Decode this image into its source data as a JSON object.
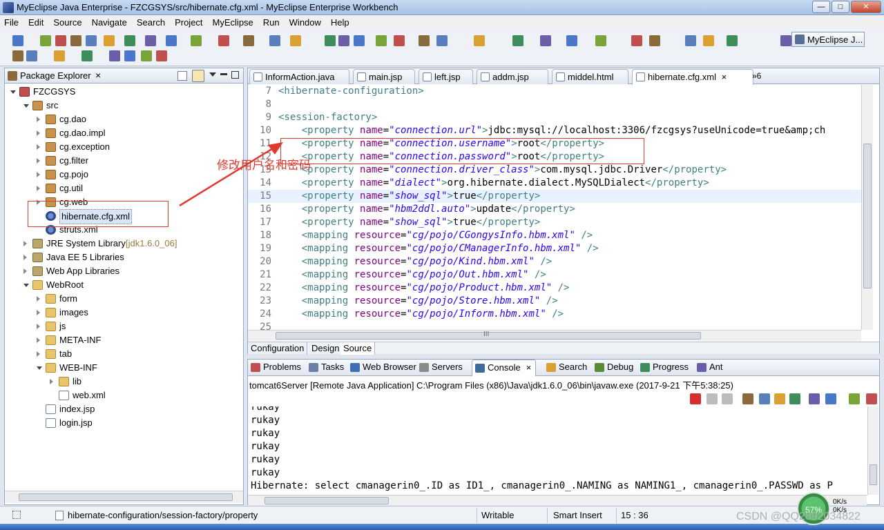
{
  "window": {
    "title": "MyEclipse Java Enterprise - FZCGSYS/src/hibernate.cfg.xml - MyEclipse Enterprise Workbench",
    "min": "0",
    "max": "1",
    "close": "r"
  },
  "menu": [
    "File",
    "Edit",
    "Source",
    "Navigate",
    "Search",
    "Project",
    "MyEclipse",
    "Run",
    "Window",
    "Help"
  ],
  "perspective": {
    "label": "MyEclipse J..."
  },
  "package_explorer": {
    "title": "Package Explorer",
    "close": "×",
    "tree": [
      {
        "label": "FZCGSYS",
        "icon": "project-icon",
        "depth": 0,
        "open": true
      },
      {
        "label": "src",
        "icon": "source-folder-icon",
        "depth": 1,
        "open": true
      },
      {
        "label": "cg.dao",
        "icon": "package-icon",
        "depth": 2
      },
      {
        "label": "cg.dao.impl",
        "icon": "package-icon",
        "depth": 2
      },
      {
        "label": "cg.exception",
        "icon": "package-icon",
        "depth": 2
      },
      {
        "label": "cg.filter",
        "icon": "package-icon",
        "depth": 2
      },
      {
        "label": "cg.pojo",
        "icon": "package-icon",
        "depth": 2
      },
      {
        "label": "cg.util",
        "icon": "package-icon",
        "depth": 2
      },
      {
        "label": "cg.web",
        "icon": "package-icon",
        "depth": 2
      },
      {
        "label": "hibernate.cfg.xml",
        "icon": "hibernate-config-icon",
        "depth": 2,
        "selected": true
      },
      {
        "label": "struts.xml",
        "icon": "xml-config-icon",
        "depth": 2
      },
      {
        "label": "JRE System Library",
        "suffix": "[jdk1.6.0_06]",
        "icon": "library-icon",
        "depth": 1
      },
      {
        "label": "Java EE 5 Libraries",
        "icon": "library-icon",
        "depth": 1
      },
      {
        "label": "Web App Libraries",
        "icon": "library-icon",
        "depth": 1
      },
      {
        "label": "WebRoot",
        "icon": "folder-icon",
        "depth": 1,
        "open": true
      },
      {
        "label": "form",
        "icon": "folder-icon",
        "depth": 2
      },
      {
        "label": "images",
        "icon": "folder-icon",
        "depth": 2
      },
      {
        "label": "js",
        "icon": "folder-icon",
        "depth": 2
      },
      {
        "label": "META-INF",
        "icon": "folder-icon",
        "depth": 2
      },
      {
        "label": "tab",
        "icon": "folder-icon",
        "depth": 2
      },
      {
        "label": "WEB-INF",
        "icon": "folder-icon",
        "depth": 2,
        "open": true
      },
      {
        "label": "lib",
        "icon": "folder-icon",
        "depth": 3
      },
      {
        "label": "web.xml",
        "icon": "xml-file-icon",
        "depth": 3
      },
      {
        "label": "index.jsp",
        "icon": "jsp-file-icon",
        "depth": 2
      },
      {
        "label": "login.jsp",
        "icon": "jsp-file-icon",
        "depth": 2
      }
    ]
  },
  "editor": {
    "tabs": [
      "InformAction.java",
      "main.jsp",
      "left.jsp",
      "addm.jsp",
      "middel.html",
      "hibernate.cfg.xml"
    ],
    "active_tab": 5,
    "overflow": "»6",
    "lines": [
      {
        "n": "7",
        "html": "<span class=\"tag\">&lt;hibernate-configuration&gt;</span>"
      },
      {
        "n": "8",
        "html": ""
      },
      {
        "n": "9",
        "html": "<span class=\"tag\">&lt;session-factory&gt;</span>"
      },
      {
        "n": "10",
        "html": "    <span class=\"tag\">&lt;property</span> <span class=\"att\">name</span>=<span class=\"val\">\"connection.url\"</span><span class=\"tag\">&gt;</span>jdbc:mysql://localhost:3306/fzcgsys?useUnicode=true&amp;amp;ch"
      },
      {
        "n": "11",
        "html": "    <span class=\"tag\">&lt;property</span> <span class=\"att\">name</span>=<span class=\"val\">\"connection.username\"</span><span class=\"tag\">&gt;</span>root<span class=\"tag\">&lt;/property&gt;</span>"
      },
      {
        "n": "12",
        "html": "    <span class=\"tag\">&lt;property</span> <span class=\"att\">name</span>=<span class=\"val\">\"connection.password\"</span><span class=\"tag\">&gt;</span>root<span class=\"tag\">&lt;/property&gt;</span>"
      },
      {
        "n": "13",
        "html": "    <span class=\"tag\">&lt;property</span> <span class=\"att\">name</span>=<span class=\"val\">\"connection.driver_class\"</span><span class=\"tag\">&gt;</span>com.mysql.jdbc.Driver<span class=\"tag\">&lt;/property&gt;</span>"
      },
      {
        "n": "14",
        "html": "    <span class=\"tag\">&lt;property</span> <span class=\"att\">name</span>=<span class=\"val\">\"dialect\"</span><span class=\"tag\">&gt;</span>org.hibernate.dialect.MySQLDialect<span class=\"tag\">&lt;/property&gt;</span>"
      },
      {
        "n": "15",
        "html": "    <span class=\"tag\">&lt;property</span> <span class=\"att\">name</span>=<span class=\"val\">\"show_sql\"</span><span class=\"tag\">&gt;</span>true<span class=\"tag\">&lt;/property&gt;</span>",
        "current": true
      },
      {
        "n": "16",
        "html": "    <span class=\"tag\">&lt;property</span> <span class=\"att\">name</span>=<span class=\"val\">\"hbm2ddl.auto\"</span><span class=\"tag\">&gt;</span>update<span class=\"tag\">&lt;/property&gt;</span>"
      },
      {
        "n": "17",
        "html": "    <span class=\"tag\">&lt;property</span> <span class=\"att\">name</span>=<span class=\"val\">\"show_sql\"</span><span class=\"tag\">&gt;</span>true<span class=\"tag\">&lt;/property&gt;</span>"
      },
      {
        "n": "18",
        "html": "    <span class=\"tag\">&lt;mapping</span> <span class=\"att\">resource</span>=<span class=\"val\">\"cg/pojo/CGongysInfo.hbm.xml\"</span> <span class=\"tag\">/&gt;</span>"
      },
      {
        "n": "19",
        "html": "    <span class=\"tag\">&lt;mapping</span> <span class=\"att\">resource</span>=<span class=\"val\">\"cg/pojo/CManagerInfo.hbm.xml\"</span> <span class=\"tag\">/&gt;</span>"
      },
      {
        "n": "20",
        "html": "    <span class=\"tag\">&lt;mapping</span> <span class=\"att\">resource</span>=<span class=\"val\">\"cg/pojo/Kind.hbm.xml\"</span> <span class=\"tag\">/&gt;</span>"
      },
      {
        "n": "21",
        "html": "    <span class=\"tag\">&lt;mapping</span> <span class=\"att\">resource</span>=<span class=\"val\">\"cg/pojo/Out.hbm.xml\"</span> <span class=\"tag\">/&gt;</span>"
      },
      {
        "n": "22",
        "html": "    <span class=\"tag\">&lt;mapping</span> <span class=\"att\">resource</span>=<span class=\"val\">\"cg/pojo/Product.hbm.xml\"</span> <span class=\"tag\">/&gt;</span>"
      },
      {
        "n": "23",
        "html": "    <span class=\"tag\">&lt;mapping</span> <span class=\"att\">resource</span>=<span class=\"val\">\"cg/pojo/Store.hbm.xml\"</span> <span class=\"tag\">/&gt;</span>"
      },
      {
        "n": "24",
        "html": "    <span class=\"tag\">&lt;mapping</span> <span class=\"att\">resource</span>=<span class=\"val\">\"cg/pojo/Inform.hbm.xml\"</span> <span class=\"tag\">/&gt;</span>"
      },
      {
        "n": "25",
        "html": ""
      }
    ],
    "mode_tabs": [
      "Configuration",
      "Design",
      "Source"
    ],
    "active_mode": 2,
    "hscroll_marker": "III"
  },
  "console": {
    "tabs": [
      "Problems",
      "Tasks",
      "Web Browser",
      "Servers",
      "Console",
      "Search",
      "Debug",
      "Progress",
      "Ant"
    ],
    "active_tab": 4,
    "close": "×",
    "description": "tomcat6Server [Remote Java Application] C:\\Program Files (x86)\\Java\\jdk1.6.0_06\\bin\\javaw.exe (2017-9-21 下午5:38:25)",
    "output": [
      "rukay",
      "rukay",
      "rukay",
      "rukay",
      "rukay",
      "rukay",
      "Hibernate: select cmanagerin0_.ID as ID1_, cmanagerin0_.NAMING as NAMING1_, cmanagerin0_.PASSWD as P"
    ]
  },
  "status": {
    "path": "hibernate-configuration/session-factory/property",
    "writable": "Writable",
    "insert_mode": "Smart Insert",
    "position": "15 : 36"
  },
  "annotation": {
    "text": "修改用户名和密码"
  },
  "watermark": "CSDN @QQ2892034822",
  "gauge": {
    "percent": "57%"
  },
  "netspeed": {
    "up": "0K/s",
    "down": "0K/s"
  },
  "colors": {
    "xml_tag": "#3f7f7f",
    "xml_attr": "#7f007f",
    "xml_value": "#2a00ff",
    "annotation": "#e03a2f"
  }
}
